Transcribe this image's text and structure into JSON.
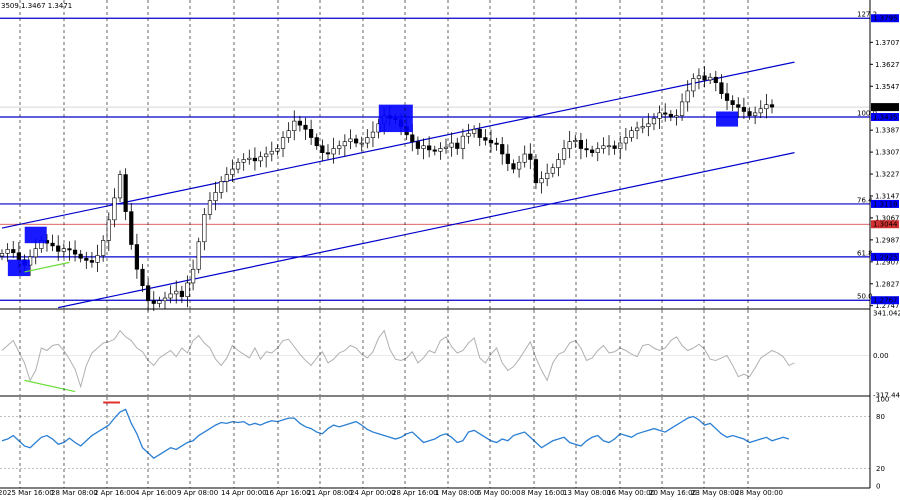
{
  "header": {
    "info": "3509 1.3467 1.3471"
  },
  "colors": {
    "level": "#0000cc",
    "level_bg": "#0000ff",
    "red_level": "#d03030",
    "bull": "#000000",
    "bear": "#000000",
    "cci": "#b0b0b0",
    "rsi": "#2a7fd4",
    "green": "#66dd33",
    "box": "#0000ff",
    "grid": "#000000"
  },
  "chart_data": [
    {
      "type": "candlestick",
      "ylim": [
        1.2735,
        1.3825
      ],
      "x_labels": [
        "25 Mar 16:00",
        "28 Mar 08:00",
        "2 Apr 16:00",
        "4 Apr 16:00",
        "9 Apr 08:00",
        "14 Apr 00:00",
        "16 Apr 16:00",
        "21 Apr 08:00",
        "24 Apr 00:00",
        "28 Apr 16:00",
        "1 May 08:00",
        "6 May 00:00",
        "8 May 16:00",
        "13 May 08:00",
        "16 May 00:00",
        "20 May 16:00",
        "23 May 08:00",
        "28 May 00:00"
      ],
      "x_label_partial": "20",
      "y_ticks": [
        "1.3707",
        "1.3627",
        "1.3547",
        "1.3387",
        "1.3307",
        "1.3227",
        "1.3147",
        "1.3067",
        "1.2987",
        "1.2907",
        "1.2827",
        "1.2747"
      ],
      "price_labels": [
        {
          "text": "1.3795",
          "value": 1.3795,
          "color": "#0000ff"
        },
        {
          "text": "1.3471",
          "value": 1.3471,
          "color": "#000000"
        },
        {
          "text": "1.3435",
          "value": 1.3435,
          "color": "#0000ff"
        },
        {
          "text": "1.3118",
          "value": 1.3118,
          "color": "#0000ff"
        },
        {
          "text": "1.3044",
          "value": 1.3044,
          "color": "#d03030"
        },
        {
          "text": "1.2925",
          "value": 1.2925,
          "color": "#0000ff"
        },
        {
          "text": "1.2767",
          "value": 1.2767,
          "color": "#0000ff"
        }
      ],
      "fib_levels": [
        {
          "label": "127.2",
          "value": 1.3795
        },
        {
          "label": "100.0",
          "value": 1.3435
        },
        {
          "label": "76.4",
          "value": 1.3118
        },
        {
          "label": "61.8",
          "value": 1.2925
        },
        {
          "label": "50.0",
          "value": 1.2767
        }
      ],
      "red_level": 1.3044,
      "last_price": 1.3471,
      "channel_lines": [
        {
          "x1": 0,
          "y1": 1.303,
          "x2": 141,
          "y2": 1.3635
        },
        {
          "x1": 10,
          "y1": 1.274,
          "x2": 141,
          "y2": 1.3305
        }
      ],
      "highlight_boxes": [
        {
          "x": 3,
          "y_top": 1.2915,
          "y_bottom": 1.2855
        },
        {
          "x": 6,
          "y_top": 1.3035,
          "y_bottom": 1.2975
        },
        {
          "x": 69,
          "y_top": 1.348,
          "y_bottom": 1.338
        },
        {
          "x": 129,
          "y_top": 1.3455,
          "y_bottom": 1.34
        }
      ],
      "green_lines": [
        {
          "x1": 4,
          "y1": 1.287,
          "x2": 12,
          "y2": 1.2905
        }
      ],
      "closes": [
        1.2938,
        1.2952,
        1.294,
        1.2915,
        1.2895,
        1.2925,
        1.2955,
        1.2985,
        1.2975,
        1.2965,
        1.2945,
        1.2955,
        1.295,
        1.2935,
        1.292,
        1.2912,
        1.2905,
        1.293,
        1.2985,
        1.306,
        1.314,
        1.3225,
        1.309,
        1.297,
        1.288,
        1.282,
        1.2765,
        1.2755,
        1.2765,
        1.2775,
        1.279,
        1.28,
        1.278,
        1.283,
        1.288,
        1.298,
        1.308,
        1.313,
        1.316,
        1.32,
        1.3225,
        1.3245,
        1.327,
        1.328,
        1.3285,
        1.3275,
        1.329,
        1.33,
        1.331,
        1.332,
        1.336,
        1.3385,
        1.342,
        1.3405,
        1.339,
        1.336,
        1.333,
        1.3305,
        1.33,
        1.332,
        1.333,
        1.3345,
        1.3355,
        1.334,
        1.334,
        1.336,
        1.338,
        1.341,
        1.344,
        1.343,
        1.3425,
        1.34,
        1.337,
        1.3345,
        1.332,
        1.333,
        1.3315,
        1.331,
        1.332,
        1.3325,
        1.334,
        1.332,
        1.3365,
        1.3375,
        1.339,
        1.336,
        1.335,
        1.334,
        1.3335,
        1.33,
        1.3265,
        1.3245,
        1.327,
        1.33,
        1.328,
        1.3195,
        1.321,
        1.323,
        1.325,
        1.328,
        1.332,
        1.3345,
        1.335,
        1.332,
        1.3315,
        1.3305,
        1.332,
        1.333,
        1.333,
        1.332,
        1.334,
        1.336,
        1.3385,
        1.3395,
        1.34,
        1.341,
        1.343,
        1.345,
        1.3445,
        1.3435,
        1.344,
        1.349,
        1.353,
        1.3575,
        1.3585,
        1.357,
        1.358,
        1.356,
        1.352,
        1.3495,
        1.348,
        1.347,
        1.3455,
        1.344,
        1.345,
        1.3465,
        1.348,
        1.3471
      ]
    },
    {
      "type": "line",
      "name_hint": "cci",
      "ylim": [
        -317.444,
        341.0423
      ],
      "y_ticks": [
        "341.0423",
        "0.00",
        "-317.444"
      ],
      "green_line": {
        "x1": 4,
        "y1": -200,
        "x2": 13,
        "y2": -290
      },
      "values": [
        40,
        80,
        120,
        30,
        -60,
        -200,
        -120,
        60,
        40,
        80,
        90,
        40,
        -30,
        -110,
        -250,
        -80,
        20,
        60,
        100,
        110,
        130,
        200,
        150,
        120,
        60,
        30,
        -40,
        -80,
        -20,
        10,
        40,
        -10,
        60,
        20,
        120,
        160,
        100,
        60,
        -30,
        -80,
        -20,
        80,
        40,
        10,
        -20,
        60,
        -30,
        30,
        20,
        60,
        120,
        130,
        70,
        10,
        -40,
        -80,
        -20,
        30,
        -60,
        -30,
        20,
        40,
        80,
        60,
        10,
        -20,
        30,
        140,
        200,
        50,
        -30,
        -40,
        -20,
        30,
        -60,
        -20,
        40,
        20,
        120,
        150,
        70,
        20,
        40,
        100,
        140,
        -20,
        -60,
        10,
        60,
        -60,
        -120,
        -90,
        -30,
        40,
        110,
        -20,
        -120,
        -200,
        -60,
        10,
        30,
        100,
        120,
        60,
        -40,
        -20,
        40,
        80,
        20,
        30,
        60,
        40,
        10,
        -10,
        80,
        90,
        60,
        40,
        60,
        120,
        150,
        80,
        40,
        60,
        90,
        50,
        -30,
        -40,
        -20,
        0,
        -80,
        -170,
        -150,
        -170,
        -100,
        -20,
        10,
        40,
        20,
        -10,
        -80,
        -60
      ]
    },
    {
      "type": "line",
      "name_hint": "rsi",
      "ylim": [
        0,
        100
      ],
      "y_ticks": [
        "100",
        "80",
        "20",
        "0"
      ],
      "ref_lines": [
        80,
        20
      ],
      "red_marker": {
        "x1": 18,
        "x2": 21,
        "y": 96
      },
      "values": [
        52,
        54,
        58,
        52,
        46,
        44,
        50,
        56,
        58,
        54,
        48,
        50,
        55,
        50,
        46,
        52,
        58,
        62,
        66,
        70,
        78,
        85,
        88,
        72,
        60,
        44,
        38,
        32,
        36,
        40,
        44,
        42,
        46,
        50,
        52,
        58,
        62,
        66,
        70,
        73,
        72,
        74,
        73,
        74,
        70,
        72,
        70,
        73,
        75,
        74,
        76,
        78,
        78,
        72,
        68,
        66,
        62,
        60,
        66,
        70,
        68,
        70,
        72,
        74,
        70,
        65,
        62,
        60,
        58,
        56,
        54,
        56,
        60,
        62,
        56,
        50,
        52,
        54,
        58,
        60,
        56,
        50,
        52,
        62,
        64,
        60,
        56,
        52,
        50,
        54,
        52,
        58,
        60,
        62,
        56,
        50,
        44,
        48,
        52,
        54,
        56,
        50,
        48,
        46,
        52,
        56,
        58,
        52,
        50,
        54,
        60,
        58,
        56,
        60,
        62,
        64,
        66,
        64,
        62,
        66,
        70,
        74,
        78,
        80,
        76,
        70,
        72,
        66,
        60,
        56,
        58,
        56,
        54,
        50,
        52,
        54,
        56,
        52,
        54,
        56,
        54
      ]
    }
  ]
}
